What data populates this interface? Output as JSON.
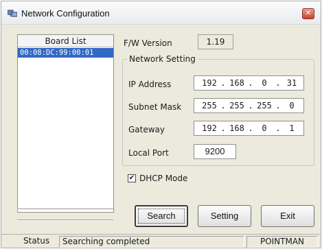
{
  "window": {
    "title": "Network Configuration",
    "close_glyph": "✕"
  },
  "board_list": {
    "header": "Board List",
    "items": [
      "00:08:DC:99:00:01"
    ],
    "selected_color": "#3168c5"
  },
  "firmware": {
    "label": "F/W Version",
    "value": "1.19"
  },
  "network_setting": {
    "title": "Network Setting",
    "ip_address": {
      "label": "IP Address",
      "octets": [
        "192",
        "168",
        "0",
        "31"
      ]
    },
    "subnet_mask": {
      "label": "Subnet Mask",
      "octets": [
        "255",
        "255",
        "255",
        "0"
      ]
    },
    "gateway": {
      "label": "Gateway",
      "octets": [
        "192",
        "168",
        "0",
        "1"
      ]
    },
    "local_port": {
      "label": "Local Port",
      "value": "9200"
    }
  },
  "dhcp": {
    "label": "DHCP Mode",
    "checked": true,
    "check_glyph": "✔"
  },
  "buttons": {
    "search": "Search",
    "setting": "Setting",
    "exit": "Exit"
  },
  "status_bar": {
    "label": "Status",
    "message": "Searching completed",
    "vendor": "POINTMAN"
  },
  "icons": {
    "app": "network-app-icon",
    "close": "close-icon",
    "checkbox": "checkbox-checked-icon"
  }
}
